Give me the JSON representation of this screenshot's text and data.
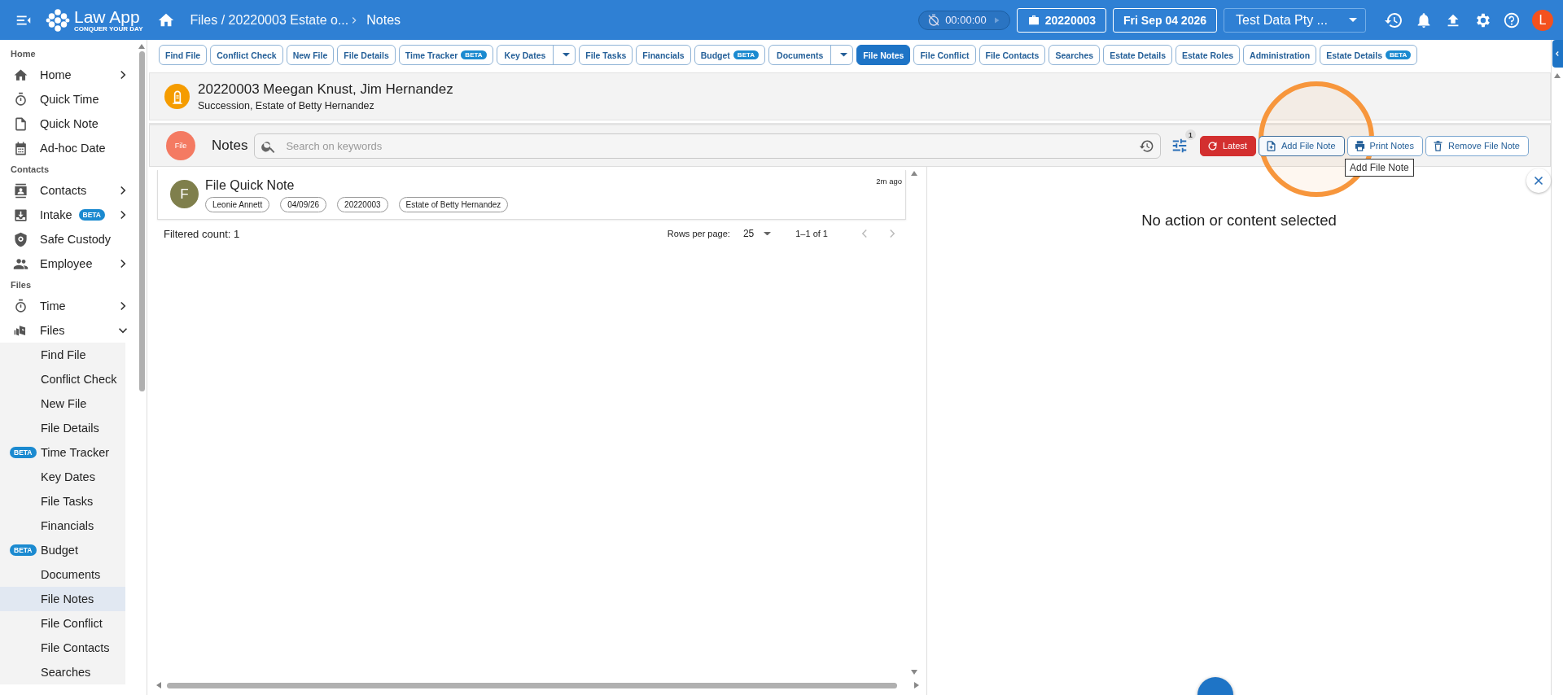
{
  "topbar": {
    "logo_title": "Law App",
    "logo_tagline": "CONQUER YOUR DAY",
    "breadcrumb": "Files / 20220003 Estate o...",
    "breadcrumb_current": "Notes",
    "timer": "00:00:00",
    "file_number": "20220003",
    "date": "Fri Sep 04 2026",
    "account": "Test Data Pty ...",
    "avatar": "L"
  },
  "sidebar": {
    "sections": [
      {
        "title": "Home",
        "items": [
          {
            "label": "Home",
            "expanded": false
          },
          {
            "label": "Quick Time"
          },
          {
            "label": "Quick Note"
          },
          {
            "label": "Ad-hoc Date"
          }
        ]
      },
      {
        "title": "Contacts",
        "items": [
          {
            "label": "Contacts",
            "expanded": false
          },
          {
            "label": "Intake",
            "badge": "BETA",
            "expanded": false
          },
          {
            "label": "Safe Custody"
          },
          {
            "label": "Employee",
            "expanded": false
          }
        ]
      },
      {
        "title": "Files",
        "items": [
          {
            "label": "Time",
            "expanded": false
          },
          {
            "label": "Files",
            "expanded": true,
            "children": [
              {
                "label": "Find File",
                "selected": false
              },
              {
                "label": "Conflict Check",
                "selected": false
              },
              {
                "label": "New File",
                "selected": false
              },
              {
                "label": "File Details",
                "selected": false
              },
              {
                "label": "Time Tracker",
                "badge": "BETA",
                "selected": false
              },
              {
                "label": "Key Dates",
                "selected": false
              },
              {
                "label": "File Tasks",
                "selected": false
              },
              {
                "label": "Financials",
                "selected": false
              },
              {
                "label": "Budget",
                "badge": "BETA",
                "selected": false
              },
              {
                "label": "Documents",
                "selected": false
              },
              {
                "label": "File Notes",
                "selected": true
              },
              {
                "label": "File Conflict",
                "selected": false
              },
              {
                "label": "File Contacts",
                "selected": false
              },
              {
                "label": "Searches",
                "selected": false
              }
            ]
          }
        ]
      }
    ]
  },
  "tabs": [
    {
      "label": "Find File",
      "kind": "plain",
      "selected": false
    },
    {
      "label": "Conflict Check",
      "kind": "plain",
      "selected": false
    },
    {
      "label": "New File",
      "kind": "plain",
      "selected": false
    },
    {
      "label": "File Details",
      "kind": "plain",
      "selected": false
    },
    {
      "label": "Time Tracker",
      "badge": "BETA",
      "kind": "plain",
      "selected": false
    },
    {
      "label": "Key Dates",
      "kind": "split",
      "selected": false
    },
    {
      "label": "File Tasks",
      "kind": "plain",
      "selected": false
    },
    {
      "label": "Financials",
      "kind": "plain",
      "selected": false
    },
    {
      "label": "Budget",
      "badge": "BETA",
      "kind": "plain",
      "selected": false
    },
    {
      "label": "Documents",
      "kind": "split",
      "selected": false
    },
    {
      "label": "File Notes",
      "kind": "plain",
      "selected": true
    },
    {
      "label": "File Conflict",
      "kind": "plain",
      "selected": false
    },
    {
      "label": "File Contacts",
      "kind": "plain",
      "selected": false
    },
    {
      "label": "Searches",
      "kind": "plain",
      "selected": false
    },
    {
      "label": "Estate Details",
      "kind": "plain",
      "selected": false
    },
    {
      "label": "Estate Roles",
      "kind": "plain",
      "selected": false
    },
    {
      "label": "Administration",
      "kind": "plain",
      "selected": false
    },
    {
      "label": "Estate Details",
      "badge": "BETA",
      "kind": "plain",
      "selected": false
    }
  ],
  "file_header": {
    "title": "20220003 Meegan Knust, Jim Hernandez",
    "subtitle": "Succession, Estate of Betty Hernandez"
  },
  "notes_toolbar": {
    "badge": "File",
    "title": "Notes",
    "search": {
      "placeholder": "Search on keywords"
    },
    "filter_count": "1",
    "buttons": [
      {
        "label": "Latest",
        "kind": "primary"
      },
      {
        "label": "Add File Note",
        "kind": "outline"
      },
      {
        "label": "Print Notes",
        "kind": "outline"
      },
      {
        "label": "Remove File Note",
        "kind": "outline"
      }
    ],
    "tooltip": "Add File Note"
  },
  "notes": [
    {
      "avatar": "F",
      "title": "File Quick Note",
      "time": "2m ago",
      "tags": [
        "Leonie Annett",
        "04/09/26",
        "20220003",
        "Estate of Betty Hernandez"
      ]
    }
  ],
  "list_footer": {
    "filtered": "Filtered count: 1",
    "rows_label": "Rows per page:",
    "rows_value": "25",
    "range": "1–1 of 1"
  },
  "detail": {
    "empty_message": "No action or content selected"
  }
}
